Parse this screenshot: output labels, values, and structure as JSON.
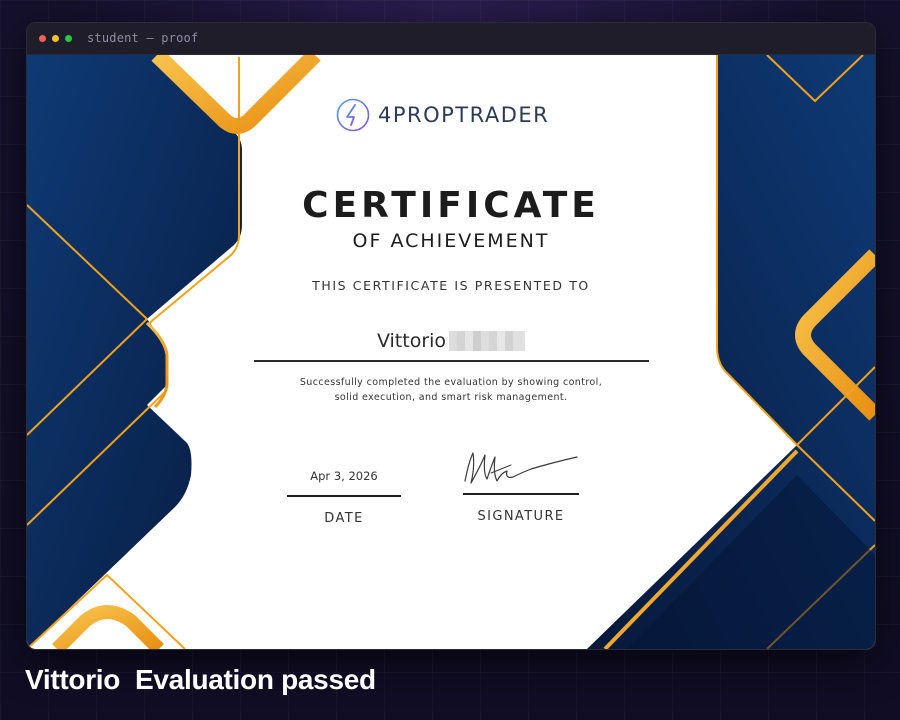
{
  "window": {
    "title": "student — proof"
  },
  "certificate": {
    "brand": "4PROPTRADER",
    "title": "CERTIFICATE",
    "subtitle": "OF ACHIEVEMENT",
    "presented_to": "THIS CERTIFICATE IS PRESENTED TO",
    "recipient_first_name": "Vittorio",
    "description_line1": "Successfully completed the evaluation by showing control,",
    "description_line2": "solid execution, and smart risk management.",
    "date_value": "Apr 3, 2026",
    "date_label": "DATE",
    "signature_label": "SIGNATURE"
  },
  "caption": {
    "text": "Vittorio  Evaluation passed"
  },
  "colors": {
    "navy": "#0d2f5f",
    "navy_dark": "#0a1f45",
    "gold": "#f2a21b",
    "gold_light": "#f9c24a",
    "logo_accent": "#7a5be0"
  },
  "icons": {
    "brand_logo": "4-lightning-circle-icon",
    "signature": "handwritten-signature"
  }
}
